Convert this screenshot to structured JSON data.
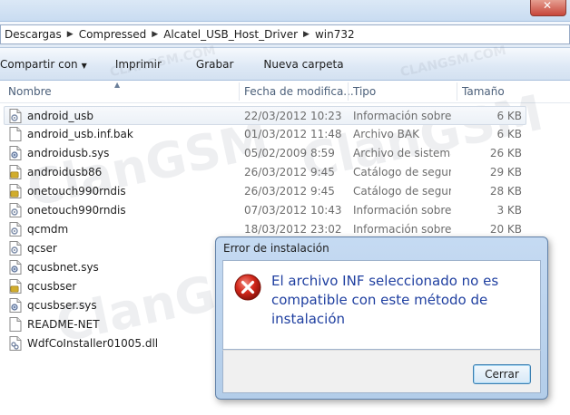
{
  "address": {
    "crumbs": [
      "Descargas",
      "Compressed",
      "Alcatel_USB_Host_Driver",
      "win732"
    ]
  },
  "toolbar": {
    "share_label": "Compartir con",
    "print_label": "Imprimir",
    "burn_label": "Grabar",
    "newfolder_label": "Nueva carpeta"
  },
  "columns": {
    "name": "Nombre",
    "date": "Fecha de modifica...",
    "type": "Tipo",
    "size": "Tamaño"
  },
  "files": [
    {
      "name": "android_usb",
      "date": "22/03/2012 10:23",
      "type": "Información sobre...",
      "size": "6 KB",
      "icon": "inf-file-icon"
    },
    {
      "name": "android_usb.inf.bak",
      "date": "01/03/2012 11:48",
      "type": "Archivo BAK",
      "size": "6 KB",
      "icon": "blank-file-icon"
    },
    {
      "name": "androidusb.sys",
      "date": "05/02/2009 8:59",
      "type": "Archivo de sistema",
      "size": "26 KB",
      "icon": "system-file-icon"
    },
    {
      "name": "androidusb86",
      "date": "26/03/2012 9:45",
      "type": "Catálogo de segur...",
      "size": "29 KB",
      "icon": "catalog-file-icon"
    },
    {
      "name": "onetouch990rndis",
      "date": "26/03/2012 9:45",
      "type": "Catálogo de segur...",
      "size": "28 KB",
      "icon": "catalog-file-icon"
    },
    {
      "name": "onetouch990rndis",
      "date": "07/03/2012 10:43",
      "type": "Información sobre...",
      "size": "3 KB",
      "icon": "inf-file-icon"
    },
    {
      "name": "qcmdm",
      "date": "18/03/2012 23:02",
      "type": "Información sobre...",
      "size": "20 KB",
      "icon": "inf-file-icon"
    },
    {
      "name": "qcser",
      "date": "",
      "type": "",
      "size": "",
      "icon": "inf-file-icon"
    },
    {
      "name": "qcusbnet.sys",
      "date": "",
      "type": "",
      "size": "",
      "icon": "system-file-icon"
    },
    {
      "name": "qcusbser",
      "date": "",
      "type": "",
      "size": "",
      "icon": "catalog-file-icon"
    },
    {
      "name": "qcusbser.sys",
      "date": "",
      "type": "",
      "size": "",
      "icon": "system-file-icon"
    },
    {
      "name": "README-NET",
      "date": "",
      "type": "",
      "size": "",
      "icon": "blank-file-icon"
    },
    {
      "name": "WdfCoInstaller01005.dll",
      "date": "",
      "type": "",
      "size": "",
      "icon": "dll-file-icon"
    }
  ],
  "watermark": {
    "text": "ClanGSM",
    "small": "CLANGSM.COM"
  },
  "dialog": {
    "title": "Error de instalación",
    "message": "El archivo INF seleccionado no es compatible con este método de instalación",
    "close_label": "Cerrar",
    "icon": "error-icon",
    "message_color": "#1f3fa0"
  }
}
